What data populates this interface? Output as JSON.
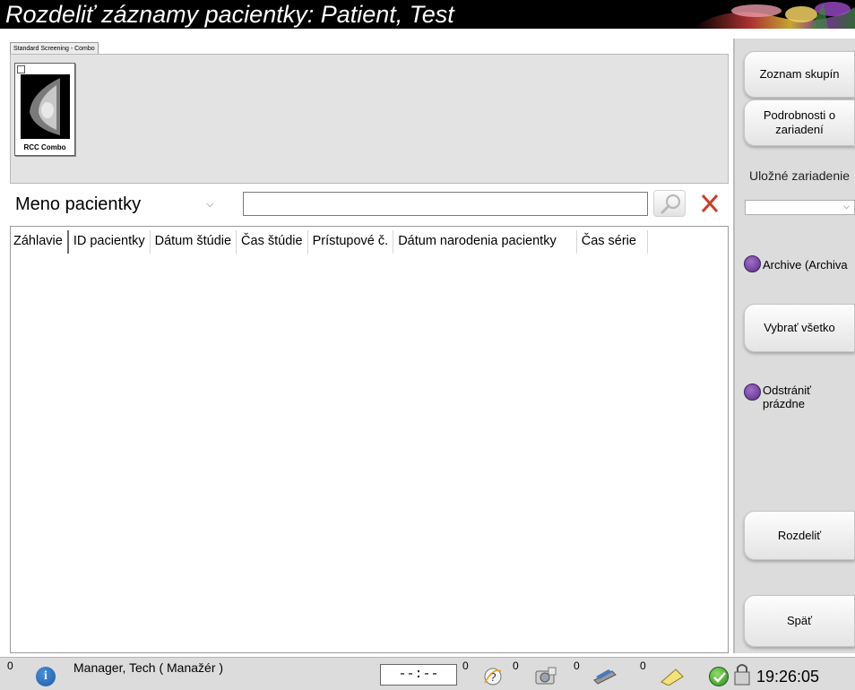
{
  "window": {
    "title": "Rozdeliť záznamy pacientky: Patient, Test"
  },
  "thumbnails": {
    "group_tab_label": "Standard Screening - Combo",
    "items": [
      {
        "label": "RCC Combo"
      }
    ]
  },
  "search": {
    "field_label": "Meno pacientky",
    "value": "",
    "placeholder": ""
  },
  "table": {
    "columns": [
      "Záhlavie",
      "ID pacientky",
      "Dátum štúdie",
      "Čas štúdie",
      "Prístupové č.",
      "Dátum narodenia pacientky",
      "Čas série"
    ],
    "rows": []
  },
  "sidebar": {
    "group_list_label": "Zoznam skupín",
    "device_details_label": "Podrobnosti o zariadení",
    "storage_label": "Uložné zariadenie",
    "storage_value": "",
    "archive_label": "Archive (Archiva",
    "select_all_label": "Vybrať všetko",
    "remove_empty_label": "Odstrániť prázdne",
    "split_label": "Rozdeliť",
    "back_label": "Späť"
  },
  "statusbar": {
    "info_count": "0",
    "user_label": "Manager, Tech ( Manažér )",
    "timer": "--:--",
    "help_count": "0",
    "media_count": "0",
    "printer_count": "0",
    "notes_count": "0",
    "clock": "19:26:05"
  },
  "colors": {
    "title_bg": "#000000",
    "panel_bg": "#dcdcdc",
    "radio_purple": "#6a3a96",
    "clear_red": "#d23a2a",
    "status_green": "#3aa022"
  },
  "icons": [
    "search-icon",
    "close-icon",
    "info-icon",
    "help-icon",
    "media-icon",
    "printer-icon",
    "notes-icon",
    "check-icon",
    "lock-icon"
  ]
}
